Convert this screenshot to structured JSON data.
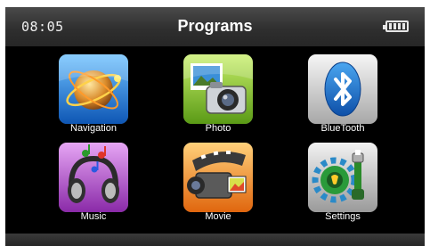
{
  "statusbar": {
    "time": "08:05",
    "title": "Programs",
    "battery_icon": "battery-full-icon"
  },
  "apps": [
    {
      "label": "Navigation",
      "icon": "globe-icon",
      "color": "#2a86d8"
    },
    {
      "label": "Photo",
      "icon": "camera-icon",
      "color": "#8ec63f"
    },
    {
      "label": "BlueTooth",
      "icon": "bluetooth-icon",
      "color": "#dcdcdc"
    },
    {
      "label": "Music",
      "icon": "headphones-icon",
      "color": "#b05ac8"
    },
    {
      "label": "Movie",
      "icon": "video-camera-icon",
      "color": "#f08a1e"
    },
    {
      "label": "Settings",
      "icon": "gears-icon",
      "color": "#c8c8c8"
    }
  ]
}
